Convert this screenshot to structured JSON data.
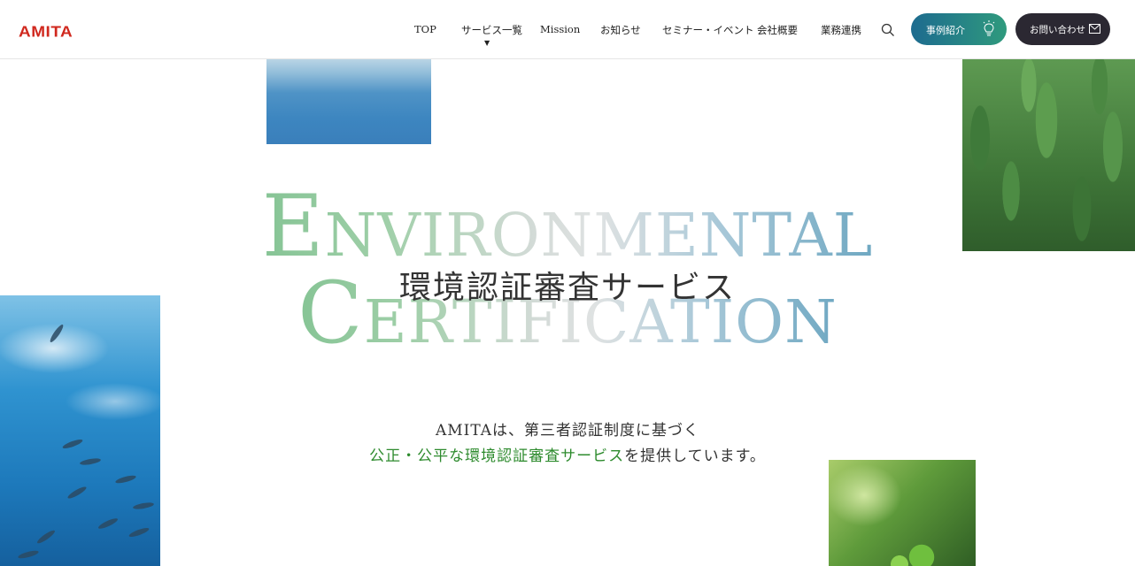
{
  "header": {
    "logo": "AMITA",
    "nav": [
      {
        "label": "TOP"
      },
      {
        "label": "サービス一覧",
        "caret": "▼"
      },
      {
        "label": "Mission"
      },
      {
        "label": "お知らせ"
      },
      {
        "label": "セミナー・イベント"
      },
      {
        "label": "会社概要"
      },
      {
        "label": "業務連携"
      }
    ],
    "search_icon": "search-icon",
    "case_button": {
      "label": "事例紹介",
      "icon": "lightbulb-icon"
    },
    "contact_button": {
      "label": "お問い合わせ",
      "icon": "mail-icon"
    }
  },
  "hero": {
    "title_en_line1": "Environmental",
    "title_en_line2": "Certification",
    "title_ja": "環境認証審査サービス",
    "lead_line1": "AMITAは、第三者認証制度に基づく",
    "lead_line2_highlight": "公正・公平な環境認証審査サービス",
    "lead_line2_rest": "を提供しています。"
  },
  "colors": {
    "brand_red": "#d0281e",
    "case_button_gradient": [
      "#1d6b8f",
      "#2f9a7d"
    ],
    "contact_button": "#2b2832",
    "highlight_green": "#2e8b2e"
  }
}
